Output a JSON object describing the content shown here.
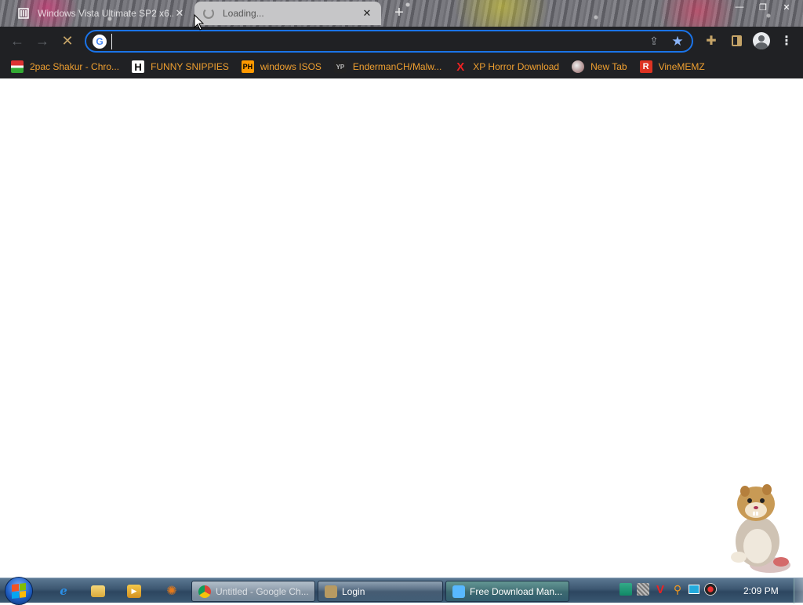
{
  "tabs": [
    {
      "title": "Windows Vista Ultimate SP2 x6...",
      "state": "inactive",
      "favicon": "archive-icon"
    },
    {
      "title": "Loading...",
      "state": "active",
      "favicon": "loading-spinner-icon"
    }
  ],
  "window_controls": {
    "minimize": "—",
    "restore": "❐",
    "close": "✕"
  },
  "toolbar": {
    "address_value": "",
    "back_icon": "←",
    "forward_icon": "→",
    "stop_icon": "✕",
    "accent_color": "#1a73e8"
  },
  "bookmarks": [
    {
      "label": "2pac Shakur - Chro...",
      "icon": "2pac-icon"
    },
    {
      "label": "FUNNY SNIPPIES",
      "icon": "h-letter-icon"
    },
    {
      "label": "windows ISOS",
      "icon": "ph-icon"
    },
    {
      "label": "EndermanCH/Malw...",
      "icon": "yp-icon"
    },
    {
      "label": "XP Horror Download",
      "icon": "x-icon"
    },
    {
      "label": "New Tab",
      "icon": "globe-icon"
    },
    {
      "label": "VineMEMZ",
      "icon": "r-letter-icon"
    }
  ],
  "bookmark_icon_text": {
    "h": "H",
    "ph": "PH",
    "yp": "YP",
    "x": "X",
    "r": "R"
  },
  "taskbar": {
    "tasks": [
      {
        "label": "Untitled - Google Ch...",
        "icon": "chrome-icon"
      },
      {
        "label": "Login",
        "icon": "login-app-icon"
      },
      {
        "label": "Free Download Man...",
        "icon": "fdm-icon"
      }
    ],
    "quick_launch": [
      "internet-explorer-icon",
      "folder-icon",
      "media-player-icon",
      "app-icon"
    ],
    "tray_icons": [
      "network-icon",
      "tray-grid-icon",
      "v-icon",
      "search-tray-icon",
      "screen-icon",
      "camera-icon"
    ],
    "clock": "2:09 PM"
  },
  "colors": {
    "toolbar_bg": "#202124",
    "bookmark_text": "#f0a030",
    "page_bg": "#ffffff"
  }
}
